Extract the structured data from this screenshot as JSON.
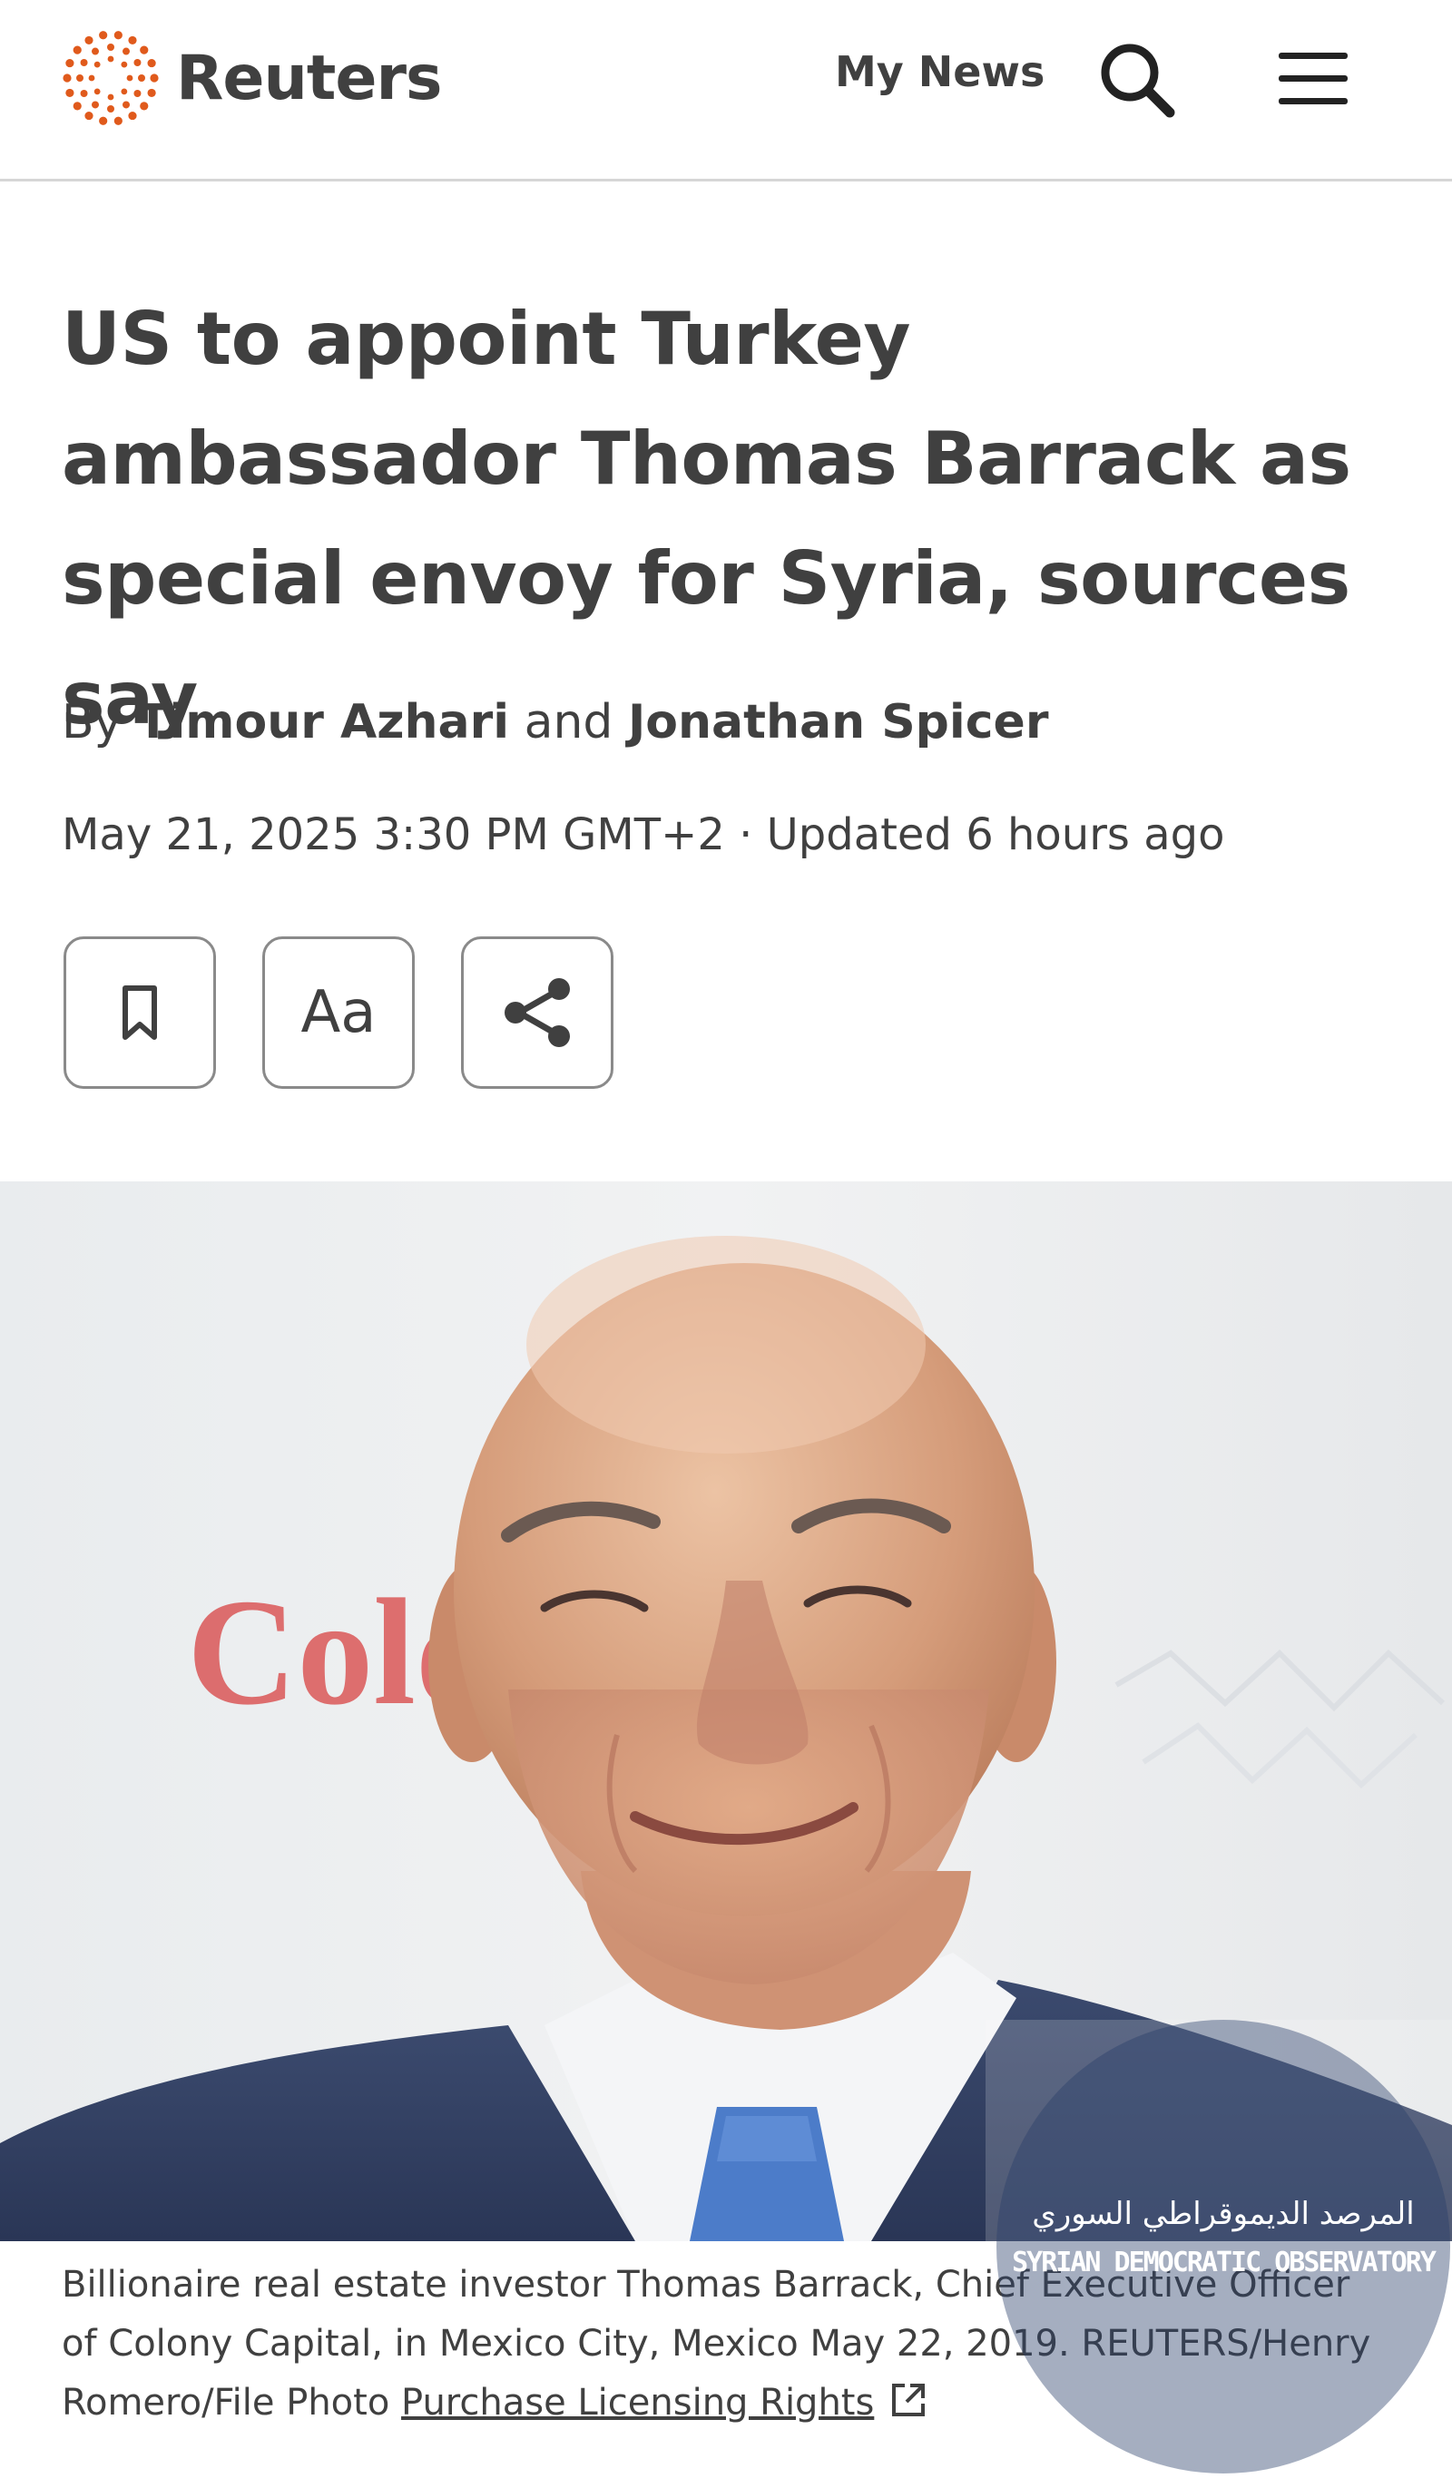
{
  "header": {
    "brand": "Reuters",
    "my_news": "My News",
    "icons": {
      "logo": "reuters-dots-logo",
      "search": "search-icon",
      "menu": "hamburger-menu-icon"
    }
  },
  "article": {
    "headline": "US to appoint Turkey ambassador Thomas Barrack as special envoy for Syria, sources say",
    "byline_prefix": "By",
    "author1": "Timour Azhari",
    "byline_and": "and",
    "author2": "Jonathan Spicer",
    "dateline": "May 21, 2025 3:30 PM GMT+2 · Updated 6 hours ago"
  },
  "actions": {
    "bookmark_icon": "bookmark-icon",
    "font_size_label": "Aa",
    "share_icon": "share-icon"
  },
  "photo": {
    "background_sign_text": "Colo"
  },
  "caption": {
    "text": "Billionaire real estate investor Thomas Barrack, Chief Executive Officer of Colony Capital, in Mexico City, Mexico May 22, 2019. REUTERS/Henry Romero/File Photo",
    "license_link": "Purchase Licensing Rights",
    "external_icon": "external-link-icon"
  },
  "watermark": {
    "arabic": "المرصد الديموقراطي السوري",
    "english": "SYRIAN DEMOCRATIC OBSERVATORY"
  },
  "colors": {
    "brand_orange": "#e05a1c",
    "text": "#404040",
    "watermark": "#283e69"
  }
}
